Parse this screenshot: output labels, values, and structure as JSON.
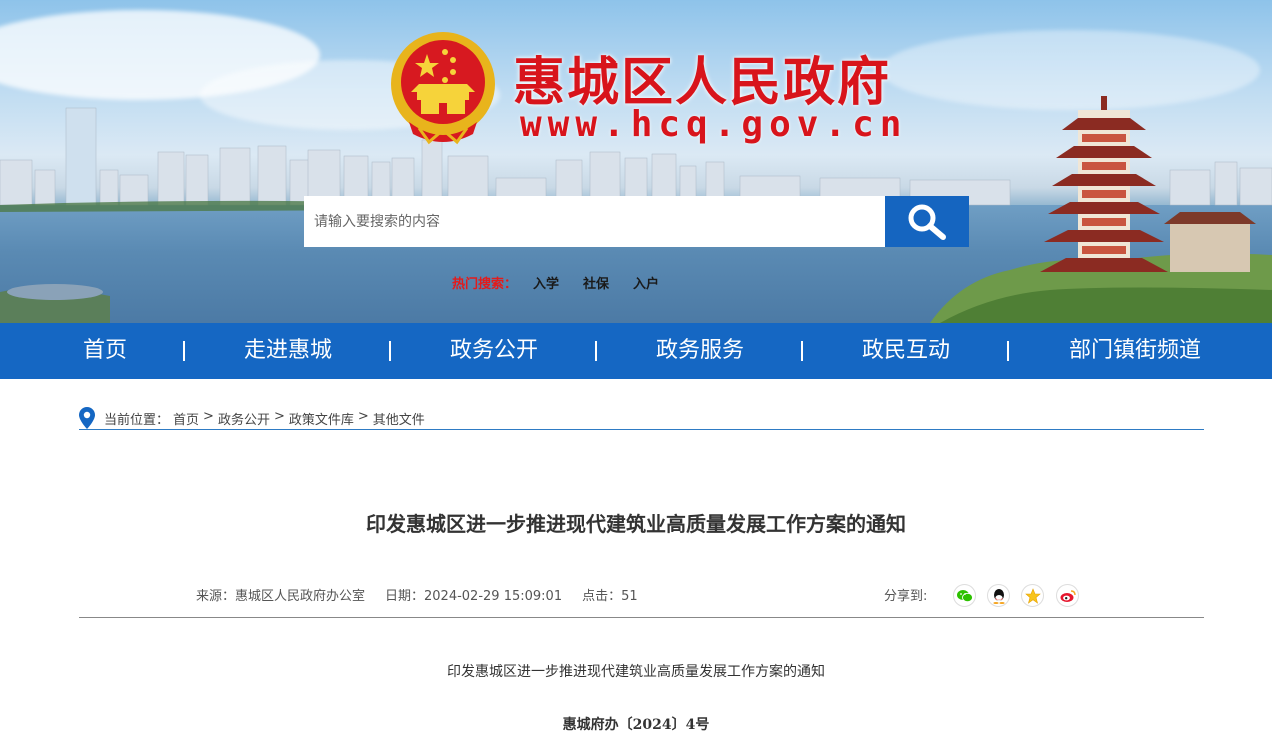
{
  "header": {
    "site_title": "惠城区人民政府",
    "site_url": "www.hcq.gov.cn",
    "search_placeholder": "请输入要搜索的内容",
    "search_icon": "magnifier-icon",
    "hot_label": "热门搜索：",
    "hot_items": [
      "入学",
      "社保",
      "入户"
    ]
  },
  "nav": {
    "items": [
      "首页",
      "走进惠城",
      "政务公开",
      "政务服务",
      "政民互动",
      "部门镇街频道"
    ],
    "separator": "|"
  },
  "breadcrumb": {
    "label": "当前位置：",
    "items": [
      "首页",
      "政务公开",
      "政策文件库",
      "其他文件"
    ],
    "separator": ">"
  },
  "article": {
    "title": "印发惠城区进一步推进现代建筑业高质量发展工作方案的通知",
    "source": "来源：惠城区人民政府办公室",
    "date": "日期：2024-02-29 15:09:01",
    "clicks": "点击：51",
    "share_label": "分享到:",
    "share_icons": [
      "wechat-icon",
      "qq-icon",
      "qzone-icon",
      "weibo-icon"
    ],
    "subtitle": "印发惠城区进一步推进现代建筑业高质量发展工作方案的通知",
    "doc_number": "惠城府办〔2024〕4号"
  },
  "colors": {
    "nav_bg": "#1567c3",
    "title_red": "#d8141b",
    "hot_red": "#e31b1b",
    "search_btn": "#1565c0"
  }
}
